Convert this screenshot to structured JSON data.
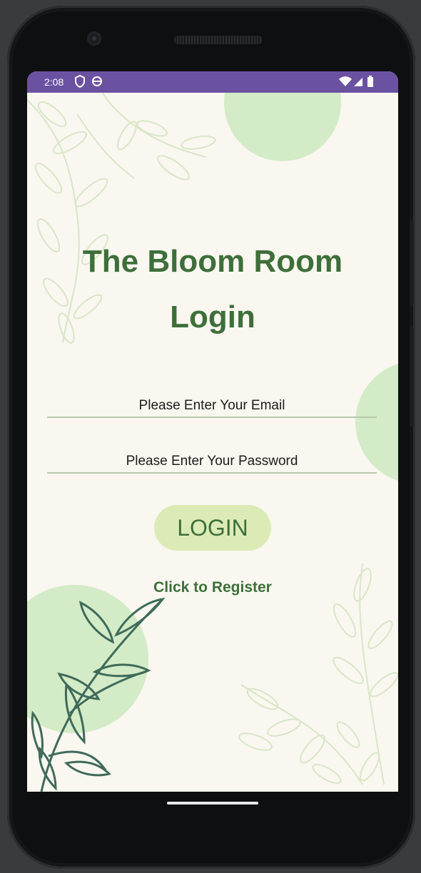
{
  "status_bar": {
    "time": "2:08",
    "icons": [
      "shield-icon",
      "sync-circle-icon",
      "wifi-icon",
      "signal-icon",
      "battery-icon"
    ]
  },
  "screen": {
    "title_line1": "The Bloom Room",
    "title_line2": "Login",
    "email_placeholder": "Please Enter Your Email",
    "password_placeholder": "Please Enter Your Password",
    "login_label": "LOGIN",
    "register_label": "Click to Register"
  },
  "colors": {
    "status_bar": "#6b51a1",
    "accent_green": "#3e6f3a",
    "button_bg": "#dcebb6",
    "screen_bg": "#f9f7f0",
    "circle_green": "#d3ebc7"
  }
}
